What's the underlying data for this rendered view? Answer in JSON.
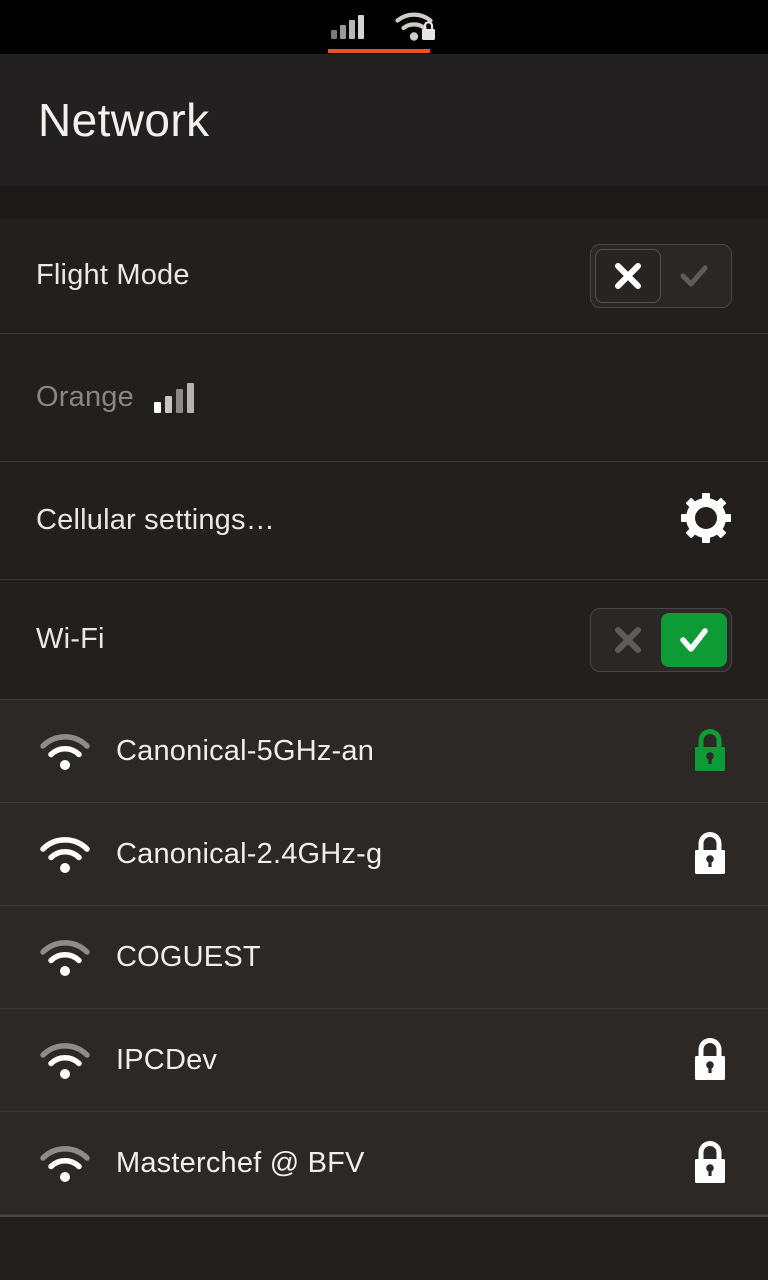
{
  "statusbar": {
    "cellular_icon": "cellular-signal-icon",
    "cellular_bars": 4,
    "wifi_icon": "wifi-secured-icon",
    "active_indicator_color": "#e95420"
  },
  "header": {
    "title": "Network"
  },
  "settings": {
    "flight_mode": {
      "label": "Flight Mode",
      "enabled": false,
      "off_icon": "close-x-icon",
      "on_icon": "check-icon"
    },
    "carrier": {
      "label": "Orange",
      "signal_icon": "cellular-signal-icon",
      "signal_bars": 4
    },
    "cellular_settings": {
      "label": "Cellular settings…",
      "icon": "gear-icon"
    },
    "wifi": {
      "label": "Wi-Fi",
      "enabled": true,
      "off_icon": "close-x-icon",
      "on_icon": "check-icon",
      "on_color": "#0e9b35"
    }
  },
  "wifi_networks": [
    {
      "ssid": "Canonical-5GHz-an",
      "signal_icon": "wifi-icon",
      "signal_level": 2,
      "secured": true,
      "lock_icon": "lock-icon",
      "lock_color": "#0e9b35",
      "connected": true
    },
    {
      "ssid": "Canonical-2.4GHz-g",
      "signal_icon": "wifi-icon",
      "signal_level": 4,
      "secured": true,
      "lock_icon": "lock-icon",
      "lock_color": "#ffffff",
      "connected": false
    },
    {
      "ssid": "COGUEST",
      "signal_icon": "wifi-icon",
      "signal_level": 2,
      "secured": false,
      "lock_icon": null,
      "lock_color": null,
      "connected": false
    },
    {
      "ssid": "IPCDev",
      "signal_icon": "wifi-icon",
      "signal_level": 2,
      "secured": true,
      "lock_icon": "lock-icon",
      "lock_color": "#ffffff",
      "connected": false
    },
    {
      "ssid": "Masterchef @ BFV",
      "signal_icon": "wifi-icon",
      "signal_level": 2,
      "secured": true,
      "lock_icon": "lock-icon",
      "lock_color": "#ffffff",
      "connected": false
    }
  ],
  "theme": {
    "background": "#1d1b1a",
    "row_background": "#221f1e",
    "list_background": "#2b2826",
    "divider": "#3a3734",
    "text": "#f0eeeb",
    "text_dim": "#8a8683",
    "accent": "#e95420",
    "green": "#0e9b35"
  }
}
